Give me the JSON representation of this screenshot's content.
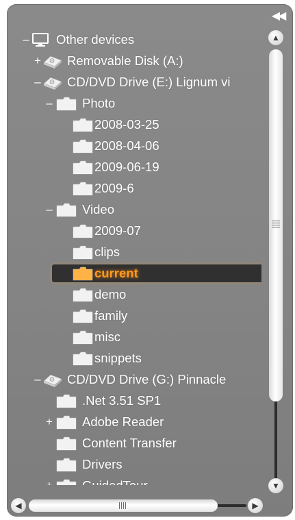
{
  "panel": {
    "collapse_icon": "double-chevron-left-icon",
    "collapse_glyph": "◀◀"
  },
  "tree": {
    "rows": [
      {
        "label": "Other devices",
        "toggle": "–",
        "icon": "monitor-icon",
        "level": 0
      },
      {
        "label": "Removable Disk (A:)",
        "toggle": "+",
        "icon": "drive-icon",
        "level": 1
      },
      {
        "label": "CD/DVD Drive (E:) Lignum vi",
        "toggle": "–",
        "icon": "drive-icon",
        "level": 1
      },
      {
        "label": "Photo",
        "toggle": "–",
        "icon": "folder-icon",
        "level": 2
      },
      {
        "label": "2008-03-25",
        "toggle": "",
        "icon": "folder-icon",
        "level": 3
      },
      {
        "label": "2008-04-06",
        "toggle": "",
        "icon": "folder-icon",
        "level": 3
      },
      {
        "label": "2009-06-19",
        "toggle": "",
        "icon": "folder-icon",
        "level": 3
      },
      {
        "label": "2009-6",
        "toggle": "",
        "icon": "folder-icon",
        "level": 3
      },
      {
        "label": "Video",
        "toggle": "–",
        "icon": "folder-icon",
        "level": 2
      },
      {
        "label": "2009-07",
        "toggle": "",
        "icon": "folder-icon",
        "level": 3
      },
      {
        "label": "clips",
        "toggle": "",
        "icon": "folder-icon",
        "level": 3
      },
      {
        "label": "current",
        "toggle": "",
        "icon": "folder-icon",
        "level": 3,
        "selected": true
      },
      {
        "label": "demo",
        "toggle": "",
        "icon": "folder-icon",
        "level": 3
      },
      {
        "label": "family",
        "toggle": "",
        "icon": "folder-icon",
        "level": 3
      },
      {
        "label": "misc",
        "toggle": "",
        "icon": "folder-icon",
        "level": 3
      },
      {
        "label": "snippets",
        "toggle": "",
        "icon": "folder-icon",
        "level": 3
      },
      {
        "label": "CD/DVD Drive (G:) Pinnacle",
        "toggle": "–",
        "icon": "drive-icon",
        "level": 1
      },
      {
        "label": ".Net 3.51 SP1",
        "toggle": "",
        "icon": "folder-icon",
        "level": 2
      },
      {
        "label": "Adobe Reader",
        "toggle": "+",
        "icon": "folder-icon",
        "level": 2
      },
      {
        "label": "Content Transfer",
        "toggle": "",
        "icon": "folder-icon",
        "level": 2
      },
      {
        "label": "Drivers",
        "toggle": "",
        "icon": "folder-icon",
        "level": 2
      },
      {
        "label": "GuidedTour",
        "toggle": "+",
        "icon": "folder-icon",
        "level": 2
      }
    ]
  },
  "scrollbars": {
    "vertical": {
      "up_glyph": "▲",
      "down_glyph": "▼"
    },
    "horizontal": {
      "left_glyph": "◀",
      "right_glyph": "▶"
    }
  },
  "colors": {
    "panel_bg": "#878787",
    "text": "#ffffff",
    "selected_text": "#ff9a1f",
    "selected_bg": "#303030",
    "folder_fill": "#f2f2f2",
    "selected_folder_fill": "#ffb347"
  }
}
